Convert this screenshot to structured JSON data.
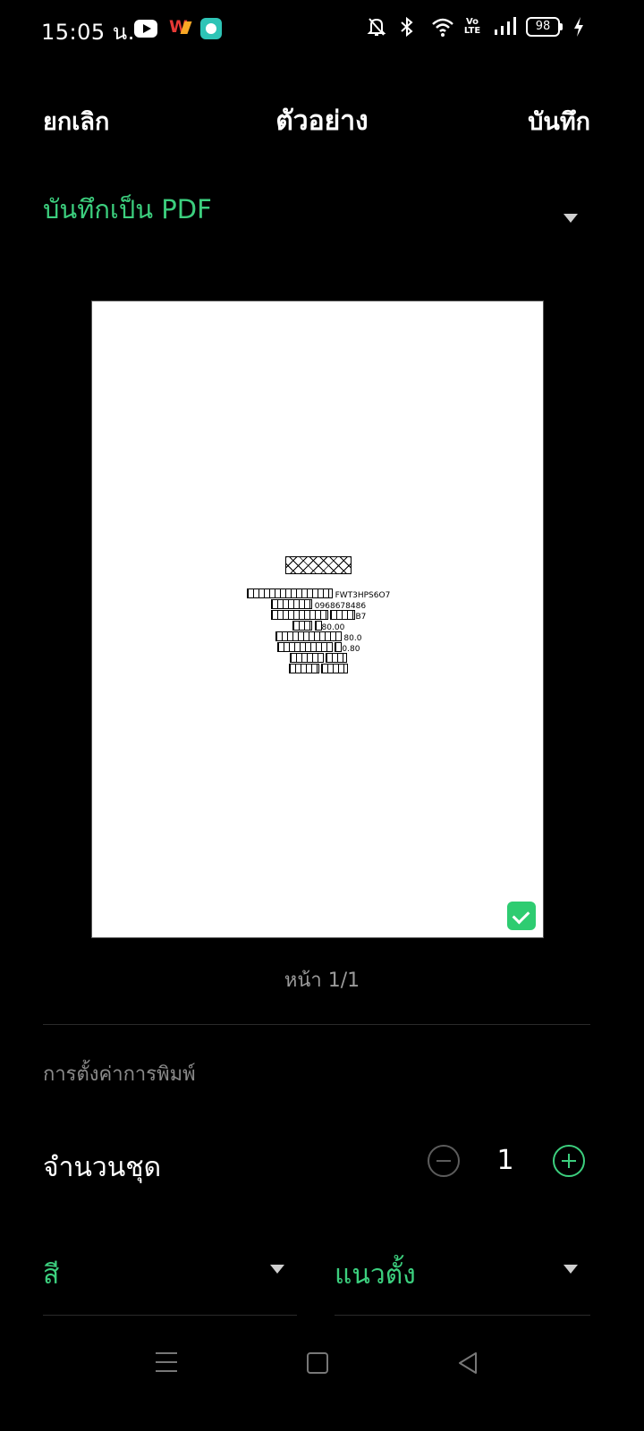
{
  "status_bar": {
    "time": "15:05 น.",
    "battery": "98",
    "network": "Vo\nLTE",
    "icons": [
      "youtube-icon",
      "w-app-icon",
      "chat-app-icon",
      "bell-off-icon",
      "bluetooth-icon",
      "wifi-icon",
      "volte-icon",
      "signal-icon",
      "battery-icon",
      "charging-icon"
    ]
  },
  "header": {
    "cancel": "ยกเลิก",
    "title": "ตัวอย่าง",
    "save": "บันทึก"
  },
  "destination": {
    "label": "บันทึกเป็น PDF"
  },
  "preview": {
    "lines": [
      {
        "suffix": "FWT3HPS6O7"
      },
      {
        "suffix": "0968678486"
      },
      {
        "suffix": "B7"
      },
      {
        "suffix": "80.00"
      },
      {
        "suffix": "80.0"
      },
      {
        "suffix": "0.80"
      },
      {
        "suffix": ""
      },
      {
        "suffix": ""
      }
    ]
  },
  "page_indicator": "หน้า 1/1",
  "settings": {
    "heading": "การตั้งค่าการพิมพ์",
    "copies_label": "จำนวนชุด",
    "copies_value": "1",
    "color_label": "สี",
    "orientation_label": "แนวตั้ง"
  },
  "colors": {
    "accent": "#3ccf7e",
    "background": "#000000",
    "check": "#2ecc71"
  }
}
